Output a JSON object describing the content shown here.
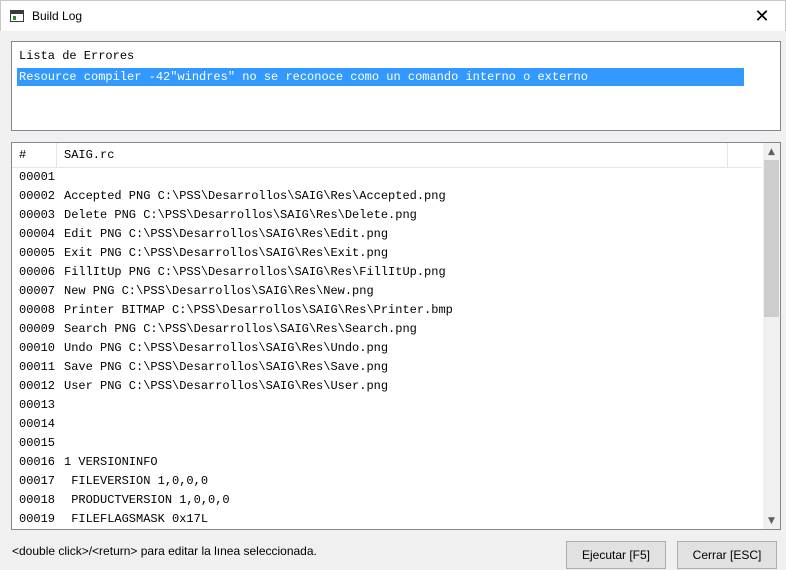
{
  "window": {
    "title": "Build Log"
  },
  "errors": {
    "header": "Lista de Errores",
    "items": [
      "Resource compiler -42\"windres\" no se reconoce como un comando interno o externo"
    ]
  },
  "code": {
    "col_num": "#",
    "col_file": "SAIG.rc",
    "rows": [
      {
        "num": "00001",
        "text": ""
      },
      {
        "num": "00002",
        "text": "Accepted PNG C:\\PSS\\Desarrollos\\SAIG\\Res\\Accepted.png"
      },
      {
        "num": "00003",
        "text": "Delete PNG C:\\PSS\\Desarrollos\\SAIG\\Res\\Delete.png"
      },
      {
        "num": "00004",
        "text": "Edit PNG C:\\PSS\\Desarrollos\\SAIG\\Res\\Edit.png"
      },
      {
        "num": "00005",
        "text": "Exit PNG C:\\PSS\\Desarrollos\\SAIG\\Res\\Exit.png"
      },
      {
        "num": "00006",
        "text": "FillItUp PNG C:\\PSS\\Desarrollos\\SAIG\\Res\\FillItUp.png"
      },
      {
        "num": "00007",
        "text": "New PNG C:\\PSS\\Desarrollos\\SAIG\\Res\\New.png"
      },
      {
        "num": "00008",
        "text": "Printer BITMAP C:\\PSS\\Desarrollos\\SAIG\\Res\\Printer.bmp"
      },
      {
        "num": "00009",
        "text": "Search PNG C:\\PSS\\Desarrollos\\SAIG\\Res\\Search.png"
      },
      {
        "num": "00010",
        "text": "Undo PNG C:\\PSS\\Desarrollos\\SAIG\\Res\\Undo.png"
      },
      {
        "num": "00011",
        "text": "Save PNG C:\\PSS\\Desarrollos\\SAIG\\Res\\Save.png"
      },
      {
        "num": "00012",
        "text": "User PNG C:\\PSS\\Desarrollos\\SAIG\\Res\\User.png"
      },
      {
        "num": "00013",
        "text": ""
      },
      {
        "num": "00014",
        "text": ""
      },
      {
        "num": "00015",
        "text": ""
      },
      {
        "num": "00016",
        "text": "1 VERSIONINFO"
      },
      {
        "num": "00017",
        "text": " FILEVERSION 1,0,0,0"
      },
      {
        "num": "00018",
        "text": " PRODUCTVERSION 1,0,0,0"
      },
      {
        "num": "00019",
        "text": " FILEFLAGSMASK 0x17L"
      }
    ]
  },
  "status": {
    "text": "<double click>/<return> para editar la lınea seleccionada."
  },
  "buttons": {
    "run": "Ejecutar [F5]",
    "close": "Cerrar [ESC]"
  },
  "icons": {
    "window_icon": "app-window-icon",
    "close": "close-icon",
    "scroll_up": "chevron-up-icon",
    "scroll_down": "chevron-down-icon"
  },
  "colors": {
    "selection": "#3399ff",
    "button_bg": "#e1e1e1"
  }
}
